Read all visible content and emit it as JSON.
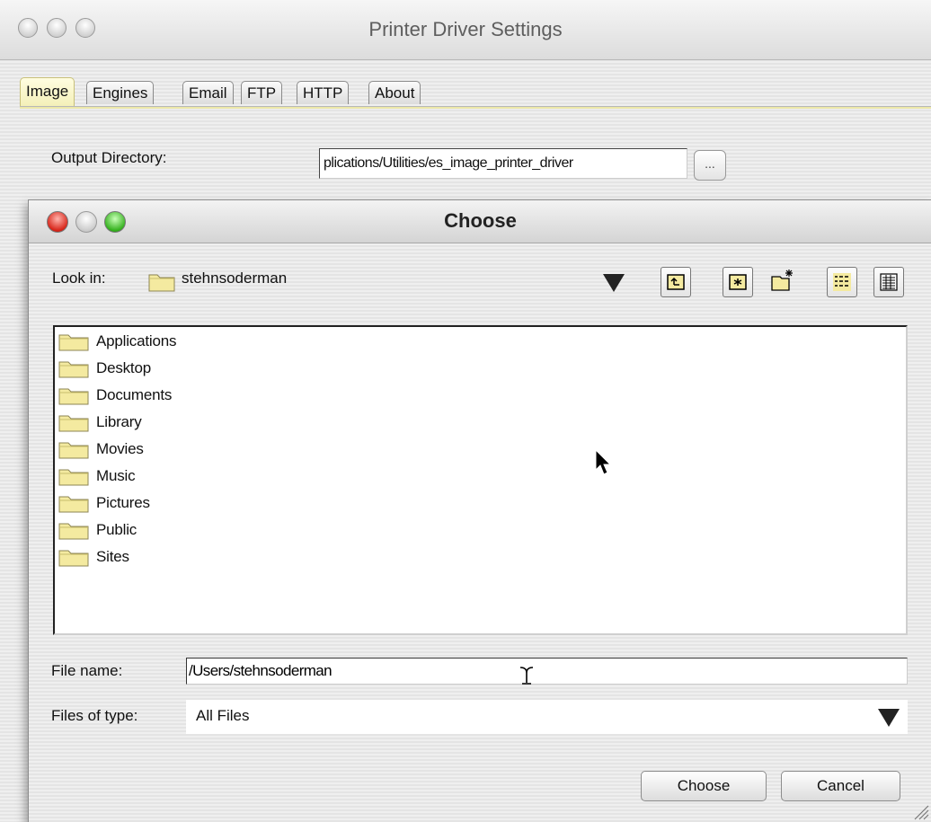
{
  "back_window": {
    "title": "Printer Driver Settings",
    "tabs": [
      {
        "label": "Image",
        "selected": true
      },
      {
        "label": "Engines",
        "selected": false
      },
      {
        "label": "Email",
        "selected": false
      },
      {
        "label": "FTP",
        "selected": false
      },
      {
        "label": "HTTP",
        "selected": false
      },
      {
        "label": "About",
        "selected": false
      }
    ],
    "output_directory": {
      "label": "Output Directory:",
      "value": "plications/Utilities/es_image_printer_driver",
      "browse_label": "..."
    }
  },
  "dialog": {
    "title": "Choose",
    "look_in": {
      "label": "Look in:",
      "value": "stehnsoderman"
    },
    "toolbar": [
      "up-one-level-icon",
      "home-folder-icon",
      "new-folder-icon",
      "list-view-icon",
      "details-view-icon"
    ],
    "files": [
      {
        "name": "Applications"
      },
      {
        "name": "Desktop"
      },
      {
        "name": "Documents"
      },
      {
        "name": "Library"
      },
      {
        "name": "Movies"
      },
      {
        "name": "Music"
      },
      {
        "name": "Pictures"
      },
      {
        "name": "Public"
      },
      {
        "name": "Sites"
      }
    ],
    "file_name": {
      "label": "File name:",
      "value": "/Users/stehnsoderman"
    },
    "files_of_type": {
      "label": "Files of type:",
      "value": "All Files"
    },
    "buttons": {
      "choose": "Choose",
      "cancel": "Cancel"
    }
  },
  "colors": {
    "folder": "#f4eaa0",
    "selected_tab": "#f6f2c0",
    "close_button": "#d8261a",
    "zoom_button": "#36b21f"
  }
}
